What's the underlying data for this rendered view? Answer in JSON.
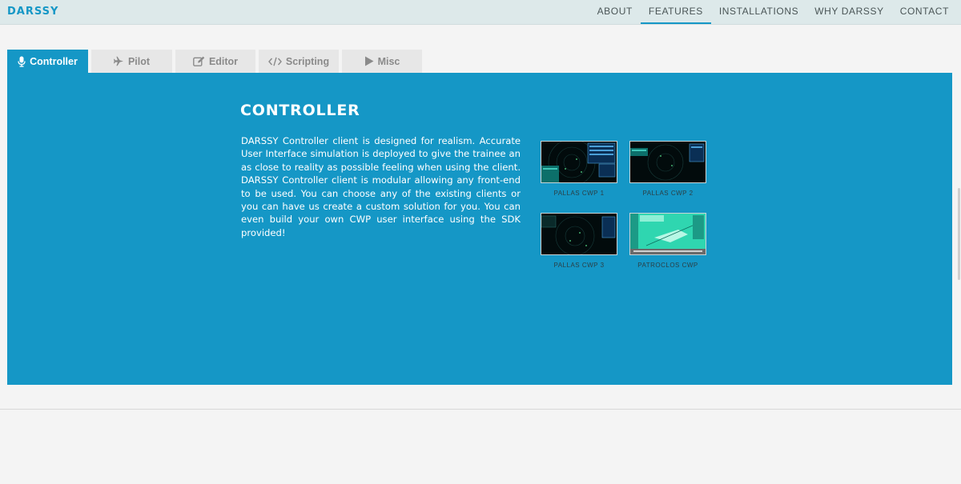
{
  "brand": "DARSSY",
  "nav": {
    "items": [
      {
        "label": "ABOUT"
      },
      {
        "label": "FEATURES"
      },
      {
        "label": "INSTALLATIONS"
      },
      {
        "label": "WHY DARSSY"
      },
      {
        "label": "CONTACT"
      }
    ],
    "active": "FEATURES"
  },
  "tabs": [
    {
      "label": "Controller",
      "icon": "microphone-icon",
      "active": true
    },
    {
      "label": "Pilot",
      "icon": "airplane-icon",
      "active": false
    },
    {
      "label": "Editor",
      "icon": "edit-icon",
      "active": false
    },
    {
      "label": "Scripting",
      "icon": "code-icon",
      "active": false
    },
    {
      "label": "Misc",
      "icon": "play-icon",
      "active": false
    }
  ],
  "panel": {
    "title": "CONTROLLER",
    "description": "DARSSY Controller client is designed for realism. Accurate User Interface simulation is deployed to give the trainee an as close to reality as possible feeling when using the client. DARSSY Controller client is modular allowing any front-end to be used. You can choose any of the existing clients or you can have us create a custom solution for you. You can even build your own CWP user interface using the SDK provided!",
    "thumbnails": [
      {
        "caption": "PALLAS CWP 1"
      },
      {
        "caption": "PALLAS CWP 2"
      },
      {
        "caption": "PALLAS CWP 3"
      },
      {
        "caption": "PATROCLOS CWP"
      }
    ]
  },
  "colors": {
    "accent": "#1597c6",
    "navbar_bg": "#dde9ea",
    "page_bg": "#f4f4f4",
    "tab_inactive_bg": "#e7e7e7"
  }
}
